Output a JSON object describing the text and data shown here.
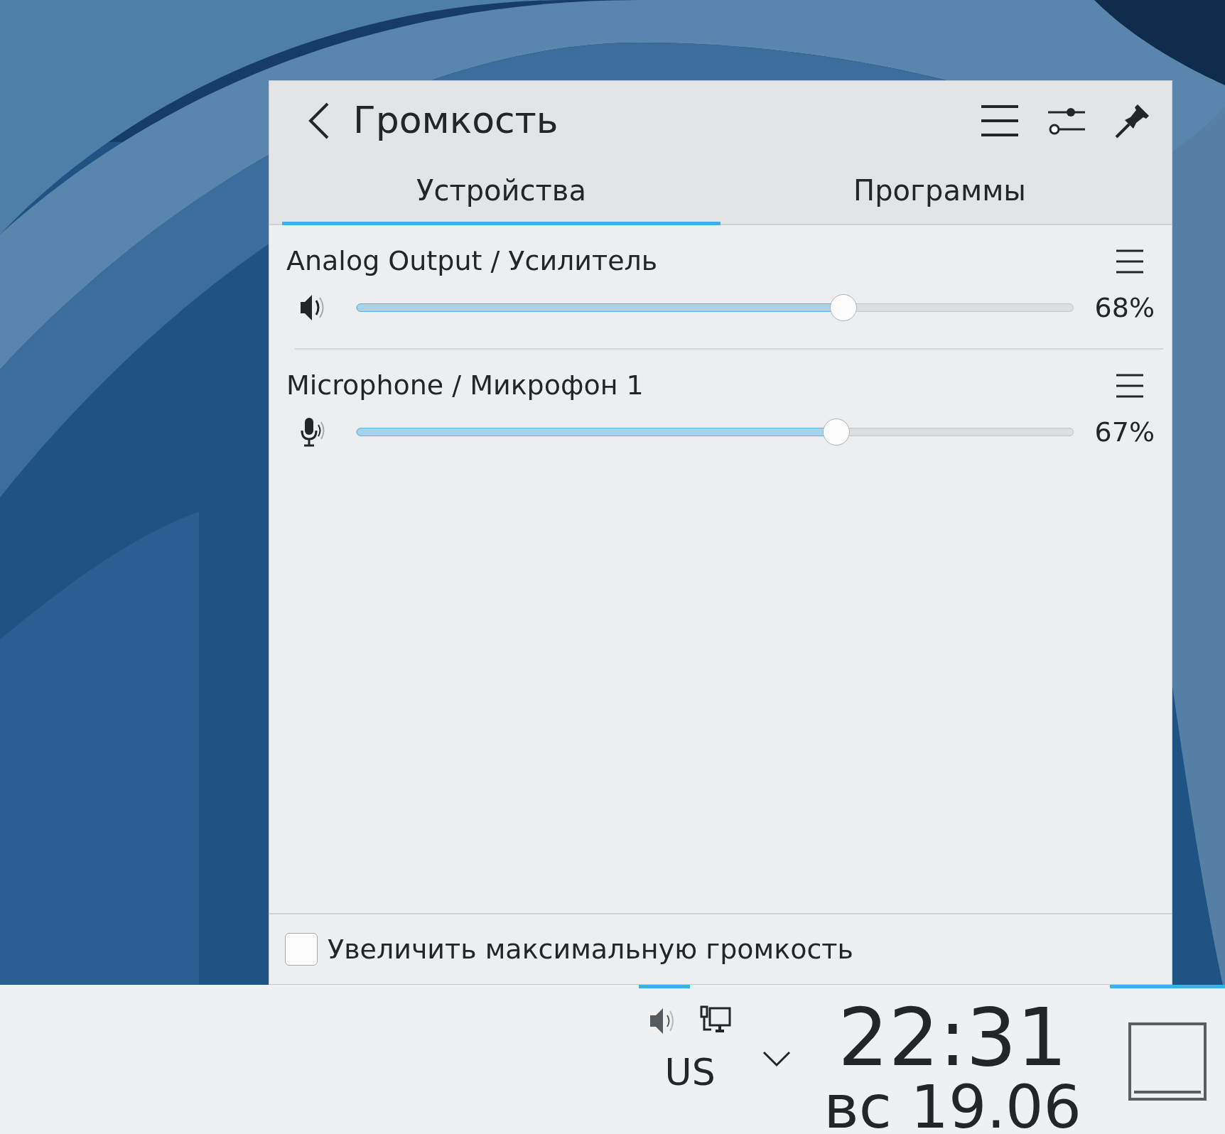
{
  "header": {
    "title": "Громкость"
  },
  "tabs": [
    {
      "label": "Устройства",
      "selected": true
    },
    {
      "label": "Программы",
      "selected": false
    }
  ],
  "devices": [
    {
      "kind": "speaker",
      "name": "Analog Output / Усилитель",
      "level": 0.68,
      "reading": "68%"
    },
    {
      "kind": "microphone",
      "name": "Microphone / Микрофон 1",
      "level": 0.67,
      "reading": "67%"
    }
  ],
  "raise_max": {
    "label": "Увеличить максимальную громкость",
    "checked": false
  },
  "taskbar": {
    "tray": [
      {
        "kind": "volume",
        "selected": true
      },
      {
        "kind": "network",
        "selected": false
      }
    ],
    "keyboard_layout": "US",
    "time": "22:31",
    "date": "вс 19.06",
    "show_desktop": {
      "selected": true
    }
  }
}
